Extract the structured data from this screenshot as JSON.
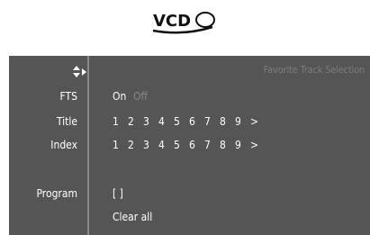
{
  "logo": {
    "text": "VCD"
  },
  "osd": {
    "title": "Favorite Track Selection",
    "fts": {
      "label": "FTS",
      "on": "On",
      "off": "Off"
    },
    "title_row": {
      "label": "Title",
      "items": [
        "1",
        "2",
        "3",
        "4",
        "5",
        "6",
        "7",
        "8",
        "9",
        ">"
      ]
    },
    "index_row": {
      "label": "Index",
      "items": [
        "1",
        "2",
        "3",
        "4",
        "5",
        "6",
        "7",
        "8",
        "9",
        ">"
      ]
    },
    "program": {
      "label": "Program",
      "value": "[ ]",
      "clear": "Clear all"
    }
  },
  "icons": {
    "selector": "up-down-right-arrow-icon"
  }
}
